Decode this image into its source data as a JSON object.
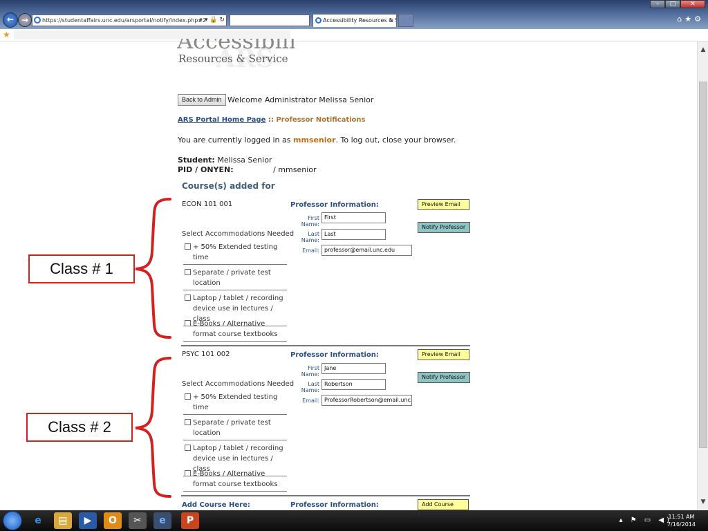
{
  "browser": {
    "url": "https://studentaffairs.unc.edu/arsportal/notify/index.php#2",
    "tab_title": "Accessibility Resources & S...",
    "tab_close": "×",
    "win_minimize": "–",
    "win_maximize": "□",
    "win_close": "✕",
    "addr_tools": "⌕ ▾ 🔒 ↻"
  },
  "logo": {
    "title": "Accessibility",
    "subtitle": "Resources & Service",
    "ghost": "ARS"
  },
  "header": {
    "back_button": "Back to Admin",
    "welcome": "Welcome Administrator Melissa Senior"
  },
  "breadcrumb": {
    "home_link": "ARS Portal Home Page",
    "separator": " :: ",
    "current": "Professor Notifications"
  },
  "login": {
    "prefix": "You are currently logged in as ",
    "username": "mmsenior",
    "suffix": ". To log out, close your browser."
  },
  "student": {
    "label": "Student:",
    "name": "Melissa Senior",
    "pid_label": "PID / ONYEN:",
    "pid_value": "/ mmsenior"
  },
  "courses_heading": "Course(s) added for",
  "accommodations_title": "Select Accommodations Needed",
  "accommodations": [
    "+ 50% Extended testing time",
    "Separate / private test location",
    "Laptop / tablet / recording device use in lectures / class",
    "E-Books / Alternative format course textbooks"
  ],
  "professor_title": "Professor Information:",
  "field_labels": {
    "first": "First Name:",
    "last": "Last Name:",
    "email": "Email:"
  },
  "buttons": {
    "preview": "Preview Email",
    "notify": "Notify Professor",
    "add_course": "Add Course"
  },
  "courses": [
    {
      "name": "ECON 101 001",
      "first": "First",
      "last": "Last",
      "email": "professor@email.unc.edu"
    },
    {
      "name": "PSYC 101 002",
      "first": "Jane",
      "last": "Robertson",
      "email": "ProfessorRobertson@email.unc.e"
    }
  ],
  "add_course": {
    "label": "Add Course Here:",
    "prof_title": "Professor Information:"
  },
  "annotations": {
    "class1": "Class # 1",
    "class2": "Class # 2",
    "brace_color": "#d32020"
  },
  "taskbar": {
    "time": "11:51 AM",
    "date": "7/16/2014",
    "tray": "▴ ⚑ ▭ ◀)"
  }
}
